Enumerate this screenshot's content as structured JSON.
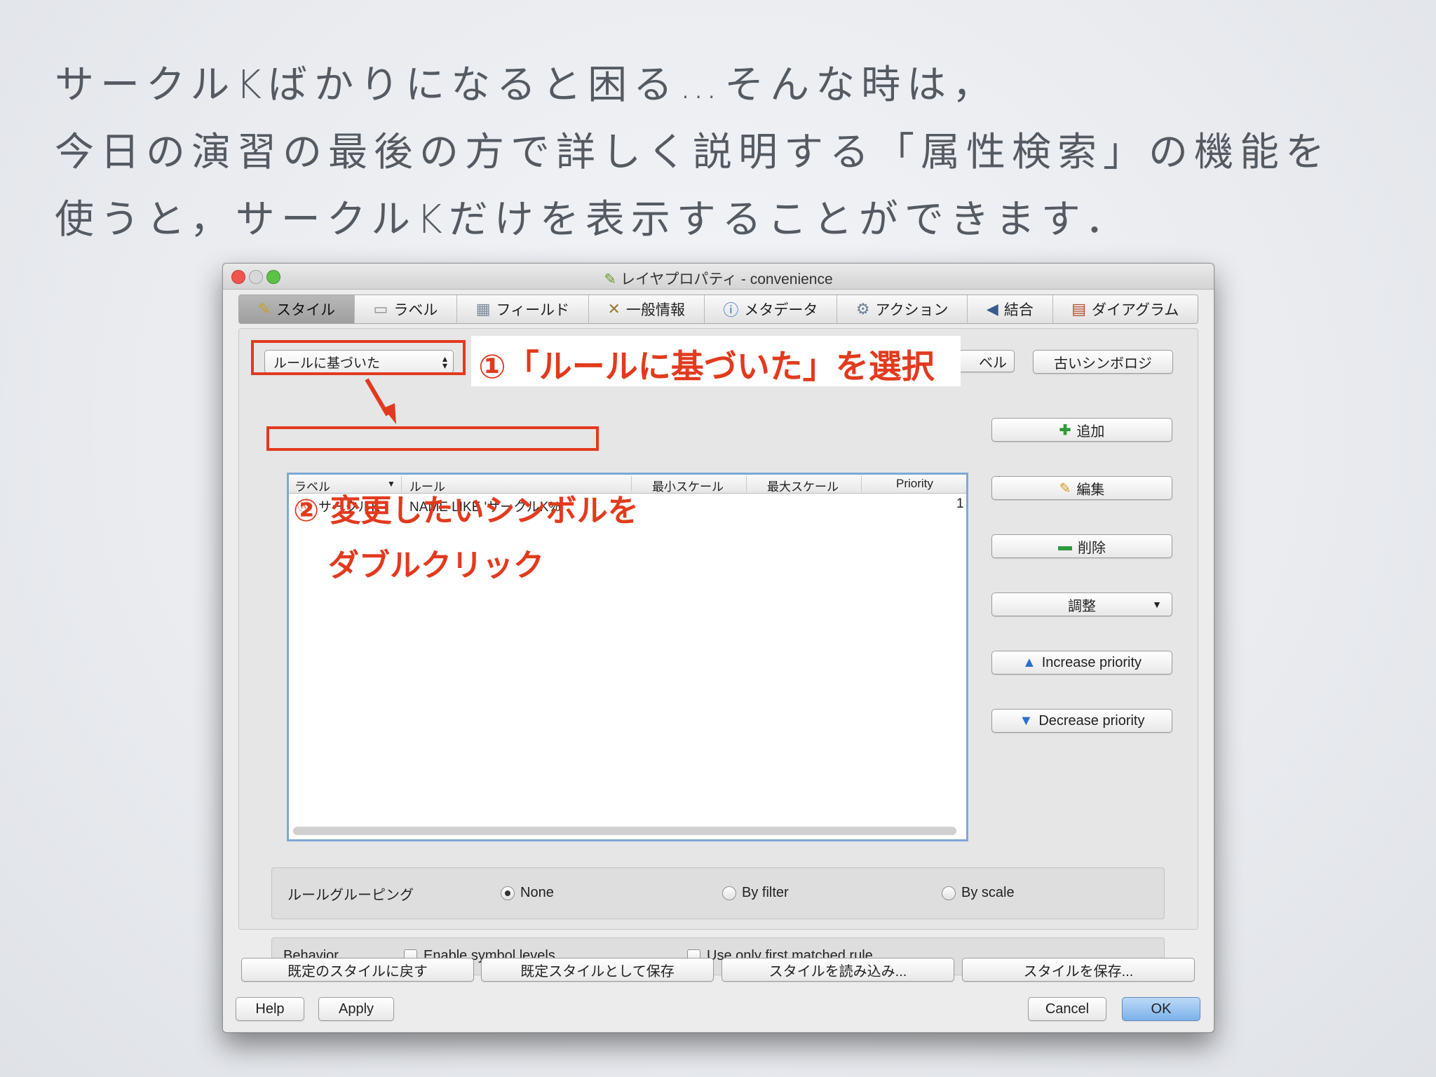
{
  "slide": {
    "lines": [
      "サークルKばかりになると困る…そんな時は，",
      "今日の演習の最後の方で詳しく説明する「属性検索」の機能を",
      "使うと，サークルKだけを表示することができます．"
    ]
  },
  "window": {
    "title": "レイヤプロパティ - convenience",
    "tabs": [
      {
        "label": "スタイル",
        "icon": "style-icon"
      },
      {
        "label": "ラベル",
        "icon": "label-icon"
      },
      {
        "label": "フィールド",
        "icon": "table-icon"
      },
      {
        "label": "一般情報",
        "icon": "tools-icon"
      },
      {
        "label": "メタデータ",
        "icon": "info-icon"
      },
      {
        "label": "アクション",
        "icon": "gears-icon"
      },
      {
        "label": "結合",
        "icon": "join-icon"
      },
      {
        "label": "ダイアグラム",
        "icon": "diagram-icon"
      }
    ],
    "active_tab": "スタイル"
  },
  "style_panel": {
    "renderer_select": "ルールに基づいた",
    "partial_button": "ベル",
    "old_symbology_button": "古いシンボロジ",
    "table": {
      "columns": [
        "ラベル",
        "ルール",
        "最小スケール",
        "最大スケール",
        "Priority"
      ],
      "rows": [
        {
          "label": "サークルK",
          "rule": "NAME LIKE 'サークルK%'",
          "min_scale": "",
          "max_scale": "",
          "priority": "1"
        }
      ]
    },
    "side_buttons": {
      "add": "追加",
      "edit": "編集",
      "delete": "削除",
      "adjust": "調整",
      "increase": "Increase priority",
      "decrease": "Decrease priority"
    },
    "grouping": {
      "label": "ルールグルーピング",
      "options": [
        "None",
        "By filter",
        "By scale"
      ],
      "selected": "None"
    },
    "behavior": {
      "label": "Behavior",
      "enable_symbol_levels": "Enable symbol levels",
      "use_first_rule": "Use only first matched rule"
    }
  },
  "bottom": {
    "restore_default": "既定のスタイルに戻す",
    "save_default": "既定スタイルとして保存",
    "load_style": "スタイルを読み込み...",
    "save_style": "スタイルを保存...",
    "help": "Help",
    "apply": "Apply",
    "cancel": "Cancel",
    "ok": "OK"
  },
  "annotations": {
    "step1": "①「ルールに基づいた」を選択",
    "step2_line1": "② 変更したいシンボルを",
    "step2_line2": "ダブルクリック",
    "color": "#e23a1e"
  }
}
